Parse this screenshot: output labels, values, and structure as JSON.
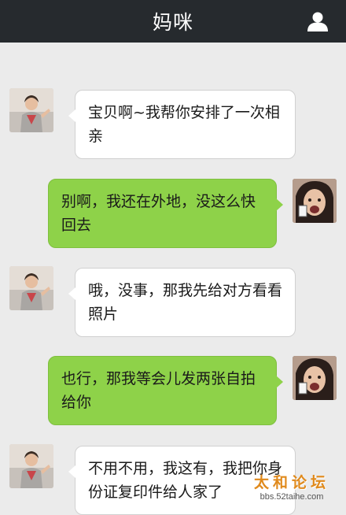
{
  "header": {
    "title": "妈咪",
    "profile_icon": "person-icon"
  },
  "messages": [
    {
      "sender": "mom",
      "text": "宝贝啊~我帮你安排了一次相亲"
    },
    {
      "sender": "me",
      "text": "别啊，我还在外地，没这么快回去"
    },
    {
      "sender": "mom",
      "text": "哦，没事，那我先给对方看看照片"
    },
    {
      "sender": "me",
      "text": "也行，那我等会儿发两张自拍给你"
    },
    {
      "sender": "mom",
      "text": "不用不用，我这有，我把你身份证复印件给人家了"
    }
  ],
  "watermark": {
    "logo": "太和论坛",
    "url": "bbs.52taihe.com"
  },
  "colors": {
    "header_bg": "#262a2e",
    "chat_bg": "#ebebeb",
    "incoming_bubble": "#ffffff",
    "outgoing_bubble": "#8ed249"
  }
}
